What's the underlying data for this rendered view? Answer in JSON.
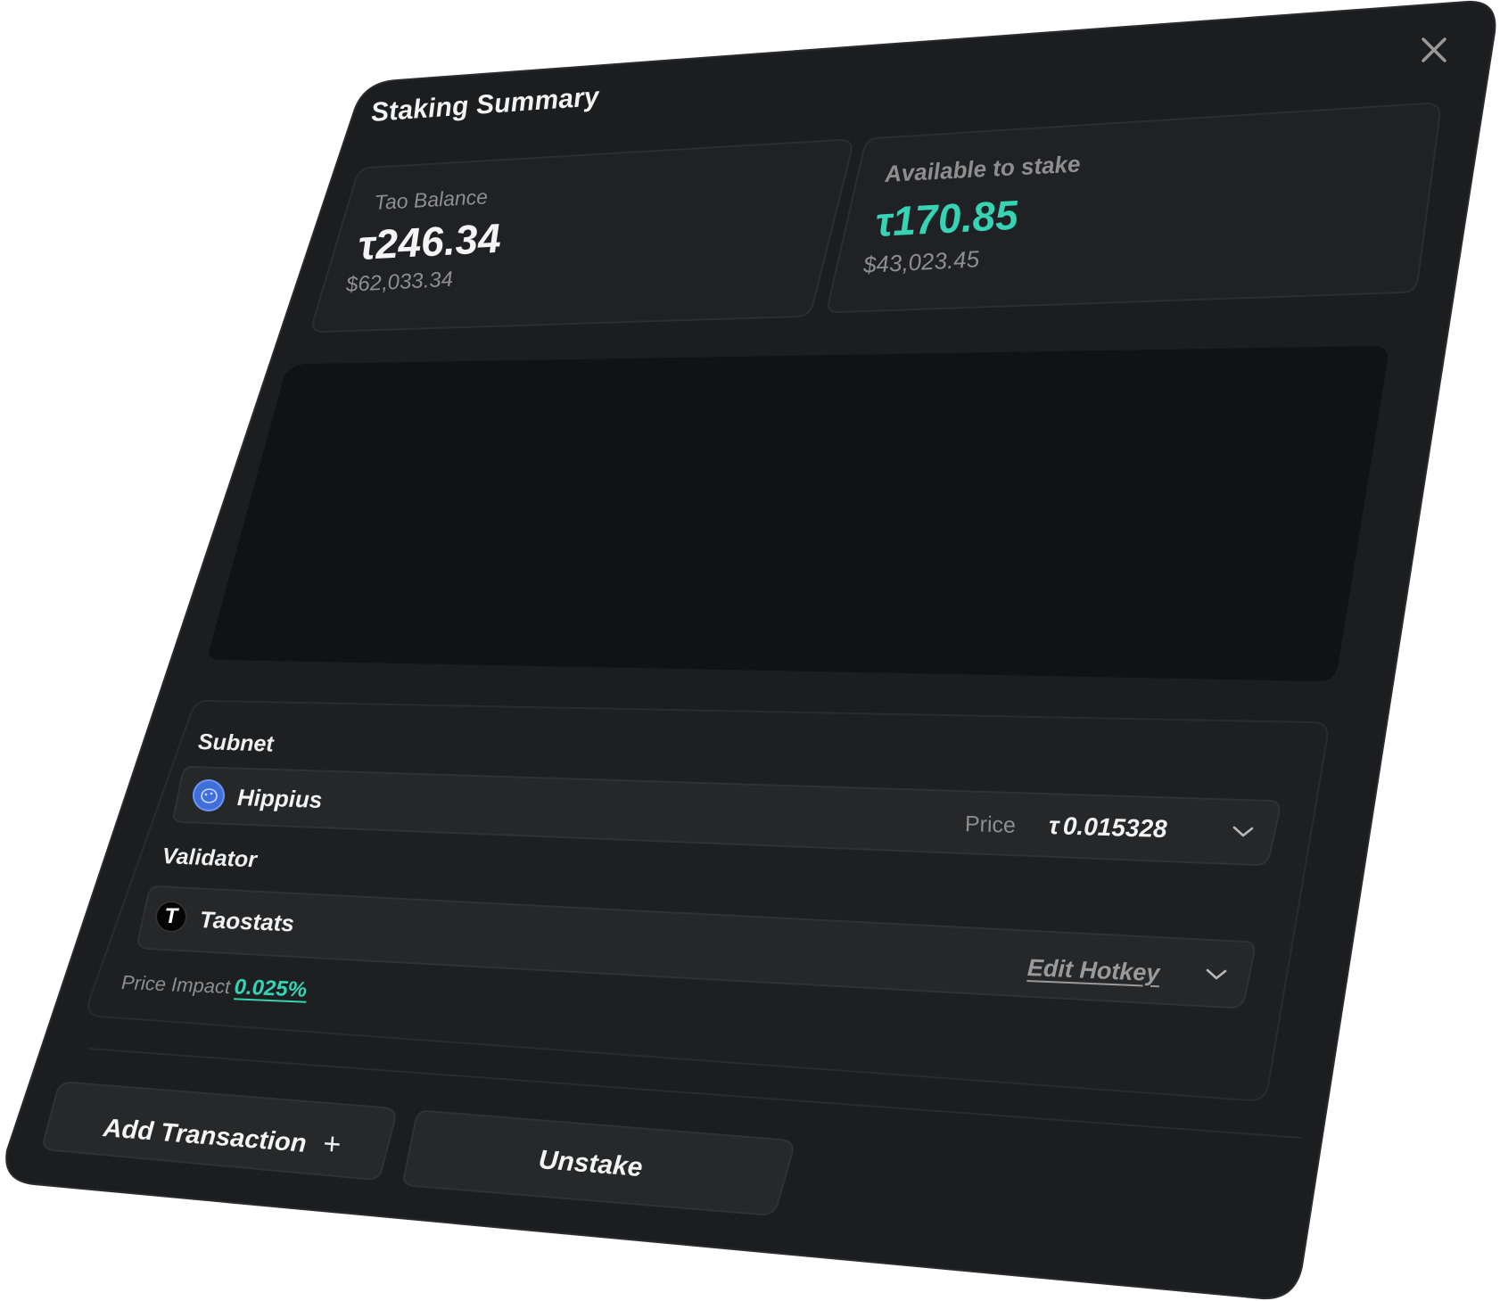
{
  "modal": {
    "title": "Staking Summary"
  },
  "tao_balance": {
    "label": "Tao Balance",
    "symbol": "τ",
    "amount": "246.34",
    "usd": "$62,033.34"
  },
  "available": {
    "label": "Available to stake",
    "symbol": "τ",
    "amount": "170.85",
    "usd": "$43,023.45"
  },
  "subnet": {
    "label": "Subnet",
    "name": "Hippius",
    "price_label": "Price",
    "price_symbol": "τ",
    "price_value": "0.015328"
  },
  "validator": {
    "label": "Validator",
    "name": "Taostats",
    "logo_letter": "T",
    "edit_label": "Edit Hotkey"
  },
  "price_impact": {
    "label": "Price Impact",
    "value": "0.025%"
  },
  "buttons": {
    "add_transaction": "Add Transaction",
    "add_symbol": "+",
    "unstake": "Unstake"
  },
  "colors": {
    "panel": "#1c1d1f",
    "card": "#222326",
    "chart_area": "#111213",
    "accent": "#36d3b4",
    "subnet_icon": "#3f6fd9"
  },
  "icons": {
    "close": "close-icon",
    "subnet_dropdown": "chevron-down-icon",
    "validator_dropdown": "chevron-down-icon"
  }
}
